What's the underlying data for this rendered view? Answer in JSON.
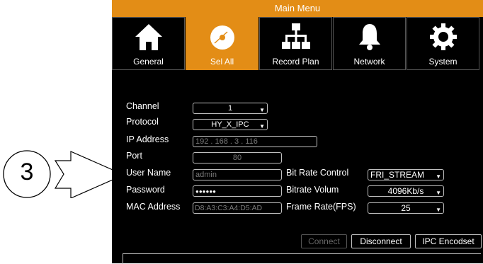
{
  "window": {
    "title": "Main Menu"
  },
  "tabs": [
    {
      "label": "General",
      "icon": "home-icon"
    },
    {
      "label": "Sel All",
      "icon": "disc-icon"
    },
    {
      "label": "Record Plan",
      "icon": "hierarchy-icon"
    },
    {
      "label": "Network",
      "icon": "bell-icon"
    },
    {
      "label": "System",
      "icon": "gear-icon"
    }
  ],
  "active_tab": "Sel All",
  "form": {
    "channel": {
      "label": "Channel",
      "value": "1"
    },
    "protocol": {
      "label": "Protocol",
      "value": "HY_X_IPC"
    },
    "ip": {
      "label": "IP Address",
      "value": "192 . 168 . 3 . 116"
    },
    "port": {
      "label": "Port",
      "value": "80"
    },
    "username": {
      "label": "User Name",
      "value": "admin"
    },
    "password": {
      "label": "Password",
      "value": "●●●●●●"
    },
    "mac": {
      "label": "MAC Address",
      "value": "D8:A3:C3:A4:D5:AD"
    },
    "bitrate_control": {
      "label": "Bit Rate Control",
      "value": "FRI_STREAM"
    },
    "bitrate_volum": {
      "label": "Bitrate Volum",
      "value": "4096Kb/s"
    },
    "frame_rate": {
      "label": "Frame Rate(FPS)",
      "value": "25"
    }
  },
  "buttons": {
    "connect": "Connect",
    "disconnect": "Disconnect",
    "encodeset": "IPC Encodset"
  },
  "annotation": {
    "number": "3"
  },
  "colors": {
    "accent": "#e38d16",
    "panel": "#000000"
  }
}
